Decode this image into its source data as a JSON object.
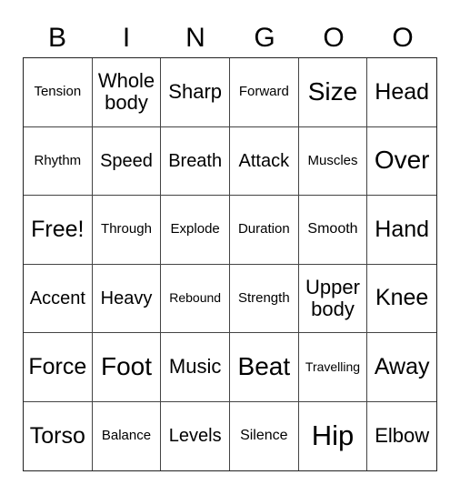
{
  "header": [
    "B",
    "I",
    "N",
    "G",
    "O",
    "O"
  ],
  "cells": [
    [
      "Tension",
      "Whole body",
      "Sharp",
      "Forward",
      "Size",
      "Head"
    ],
    [
      "Rhythm",
      "Speed",
      "Breath",
      "Attack",
      "Muscles",
      "Over"
    ],
    [
      "Free!",
      "Through",
      "Explode",
      "Duration",
      "Smooth",
      "Hand"
    ],
    [
      "Accent",
      "Heavy",
      "Rebound",
      "Strength",
      "Upper body",
      "Knee"
    ],
    [
      "Force",
      "Foot",
      "Music",
      "Beat",
      "Travelling",
      "Away"
    ],
    [
      "Torso",
      "Balance",
      "Levels",
      "Silence",
      "Hip",
      "Elbow"
    ]
  ]
}
